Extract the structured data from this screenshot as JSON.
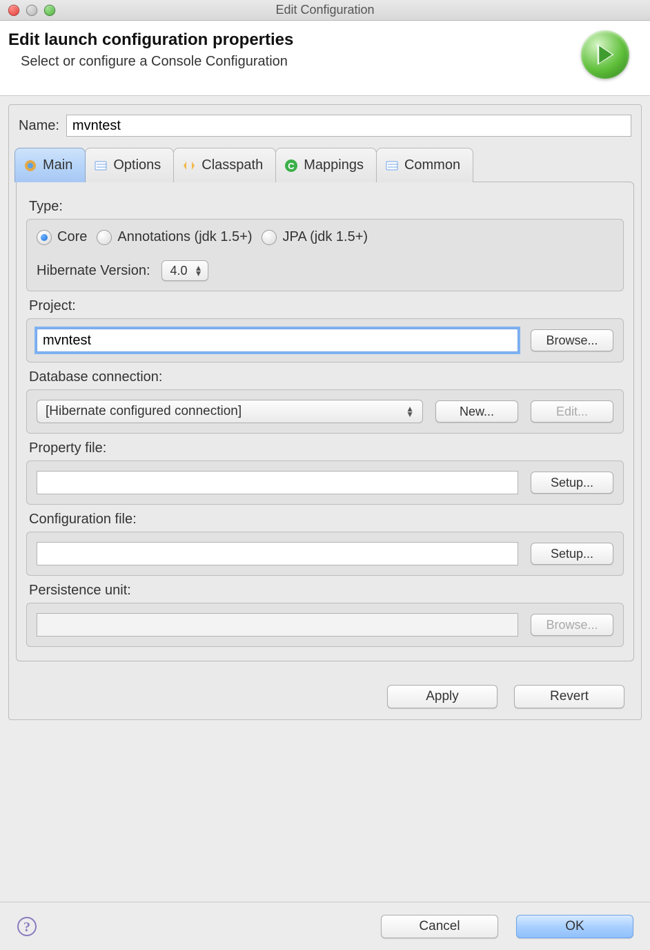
{
  "window": {
    "title": "Edit Configuration"
  },
  "header": {
    "title": "Edit launch configuration properties",
    "subtitle": "Select or configure a Console Configuration"
  },
  "name": {
    "label": "Name:",
    "value": "mvntest"
  },
  "tabs": {
    "main": {
      "label": "Main"
    },
    "options": {
      "label": "Options"
    },
    "classpath": {
      "label": "Classpath"
    },
    "mappings": {
      "label": "Mappings"
    },
    "common": {
      "label": "Common"
    }
  },
  "type": {
    "label": "Type:",
    "core": {
      "label": "Core",
      "selected": true
    },
    "annotations": {
      "label": "Annotations (jdk 1.5+)",
      "selected": false
    },
    "jpa": {
      "label": "JPA (jdk 1.5+)",
      "selected": false
    },
    "hibernate_label": "Hibernate Version:",
    "hibernate_value": "4.0"
  },
  "project": {
    "label": "Project:",
    "value": "mvntest",
    "browse": "Browse..."
  },
  "dbconn": {
    "label": "Database connection:",
    "value": "[Hibernate configured connection]",
    "new": "New...",
    "edit": "Edit..."
  },
  "propfile": {
    "label": "Property file:",
    "value": "",
    "setup": "Setup..."
  },
  "cfgfile": {
    "label": "Configuration file:",
    "value": "",
    "setup": "Setup..."
  },
  "punit": {
    "label": "Persistence unit:",
    "value": "",
    "browse": "Browse..."
  },
  "actions": {
    "apply": "Apply",
    "revert": "Revert",
    "cancel": "Cancel",
    "ok": "OK"
  }
}
